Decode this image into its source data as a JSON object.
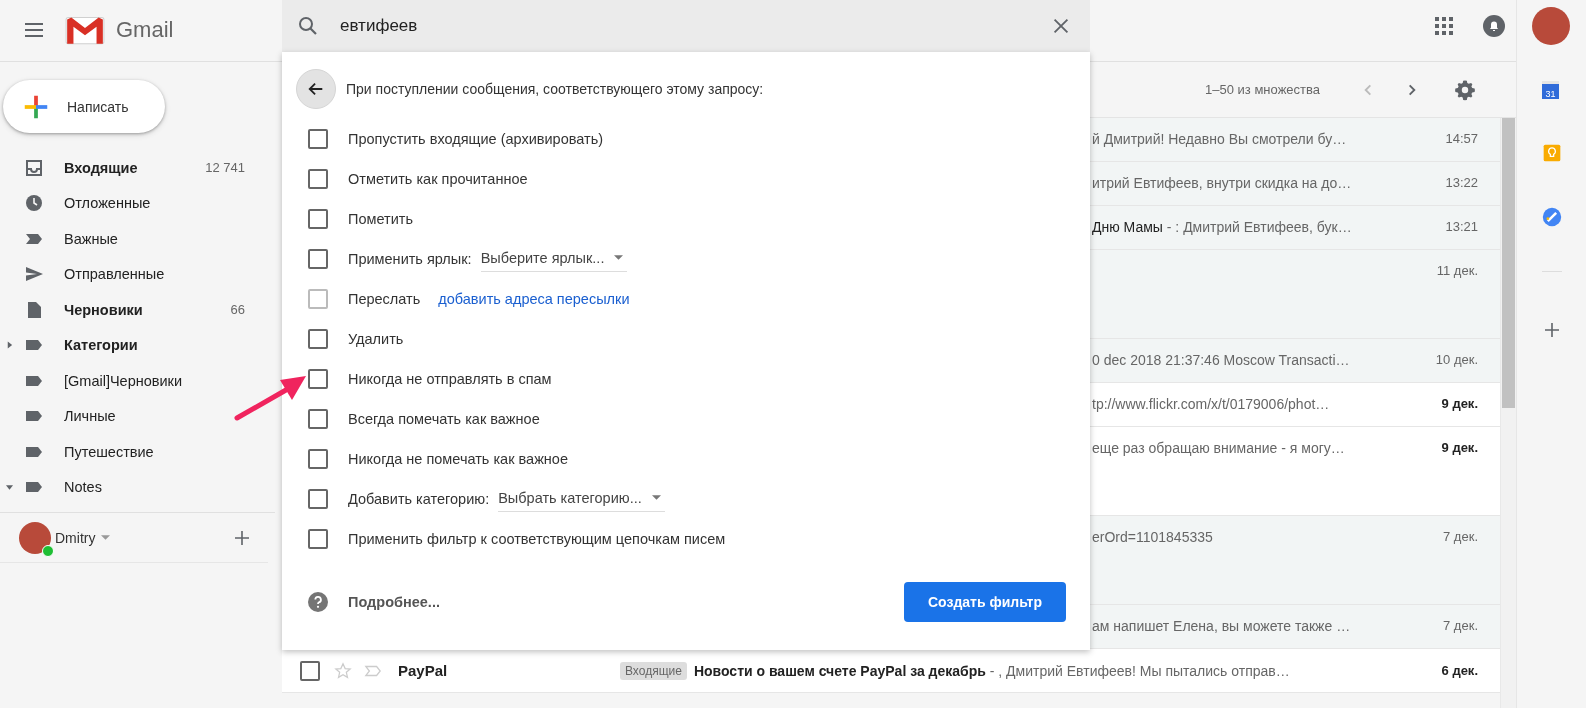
{
  "app": {
    "product_name": "Gmail"
  },
  "search": {
    "value": "евтифеев"
  },
  "compose_button": "Написать",
  "sidebar": {
    "items": [
      {
        "label": "Входящие",
        "count": "12 741",
        "unread": true
      },
      {
        "label": "Отложенные",
        "unread": false
      },
      {
        "label": "Важные",
        "unread": false
      },
      {
        "label": "Отправленные",
        "unread": false
      },
      {
        "label": "Черновики",
        "count": "66",
        "unread": true
      },
      {
        "label": "Категории",
        "unread": true,
        "expanded": false
      },
      {
        "label": "[Gmail]Черновики",
        "unread": false
      },
      {
        "label": "Личные",
        "unread": false
      },
      {
        "label": "Путешествие",
        "unread": false
      },
      {
        "label": "Notes",
        "unread": false,
        "expanded": true
      }
    ]
  },
  "account": {
    "name": "Dmitry",
    "online": true
  },
  "filter_dialog": {
    "heading": "При поступлении сообщения, соответствующего этому запросу:",
    "options": [
      {
        "kind": "plain",
        "label": "Пропустить входящие (архивировать)",
        "checked": false,
        "disabled": false
      },
      {
        "kind": "plain",
        "label": "Отметить как прочитанное",
        "checked": false,
        "disabled": false
      },
      {
        "kind": "plain",
        "label": "Пометить",
        "checked": false,
        "disabled": false
      },
      {
        "kind": "select",
        "label": "Применить ярлык:",
        "select_value": "Выберите ярлык...",
        "checked": false,
        "disabled": false
      },
      {
        "kind": "link",
        "label": "Переслать",
        "link": "добавить адреса пересылки",
        "checked": false,
        "disabled": true
      },
      {
        "kind": "plain",
        "label": "Удалить",
        "checked": false,
        "disabled": false
      },
      {
        "kind": "plain",
        "label": "Никогда не отправлять в спам",
        "checked": false,
        "disabled": false
      },
      {
        "kind": "plain",
        "label": "Всегда помечать как важное",
        "checked": false,
        "disabled": false
      },
      {
        "kind": "plain",
        "label": "Никогда не помечать как важное",
        "checked": false,
        "disabled": false
      },
      {
        "kind": "select",
        "label": "Добавить категорию:",
        "select_value": "Выбрать категорию...",
        "checked": false,
        "disabled": false
      },
      {
        "kind": "plain",
        "label": "Применить фильтр к соответствующим цепочкам писем",
        "checked": false,
        "disabled": false
      }
    ],
    "help_link": "Подробнее...",
    "create_button": "Создать фильтр"
  },
  "toolbar": {
    "range": "1–50 из множества"
  },
  "messages": [
    {
      "kind": "single",
      "covered": true,
      "snippet": "й Дмитрий! Недавно Вы смотрели бу…",
      "date": "14:57",
      "unread": false
    },
    {
      "kind": "single",
      "covered": true,
      "snippet": "итрий Евтифеев, внутри скидка на до…",
      "date": "13:22",
      "unread": false
    },
    {
      "kind": "single",
      "covered": true,
      "subject": "Дню Мамы",
      "snippet": " - : Дмитрий Евтифеев, бук…",
      "date": "13:21",
      "unread": false
    },
    {
      "kind": "tall",
      "covered": true,
      "date": "11 дек.",
      "unread": false
    },
    {
      "kind": "single",
      "covered": true,
      "snippet": "0 dec 2018 21:37:46 Moscow Transacti…",
      "date": "10 дек.",
      "unread": false
    },
    {
      "kind": "single",
      "covered": true,
      "snippet": "tp://www.flickr.com/x/t/0179006/phot…",
      "date": "9 дек.",
      "unread": true
    },
    {
      "kind": "tall",
      "covered": true,
      "snippet": "еще раз обращаю внимание - я могу…",
      "date": "9 дек.",
      "unread": true
    },
    {
      "kind": "tall",
      "covered": true,
      "snippet": "erOrd=1101845335",
      "date": "7 дек.",
      "unread": false
    },
    {
      "kind": "single",
      "covered": true,
      "snippet": "ам напишет Елена, вы можете также …",
      "date": "7 дек.",
      "unread": false
    },
    {
      "kind": "single",
      "covered": false,
      "sender": "PayPal",
      "label": "Входящие",
      "subject": "Новости о вашем счете PayPal за декабрь",
      "snippet": " - , Дмитрий Евтифеев! Мы пытались отправ…",
      "date": "6 дек.",
      "unread": true
    }
  ],
  "side_panel": {
    "calendar_day": "31"
  }
}
